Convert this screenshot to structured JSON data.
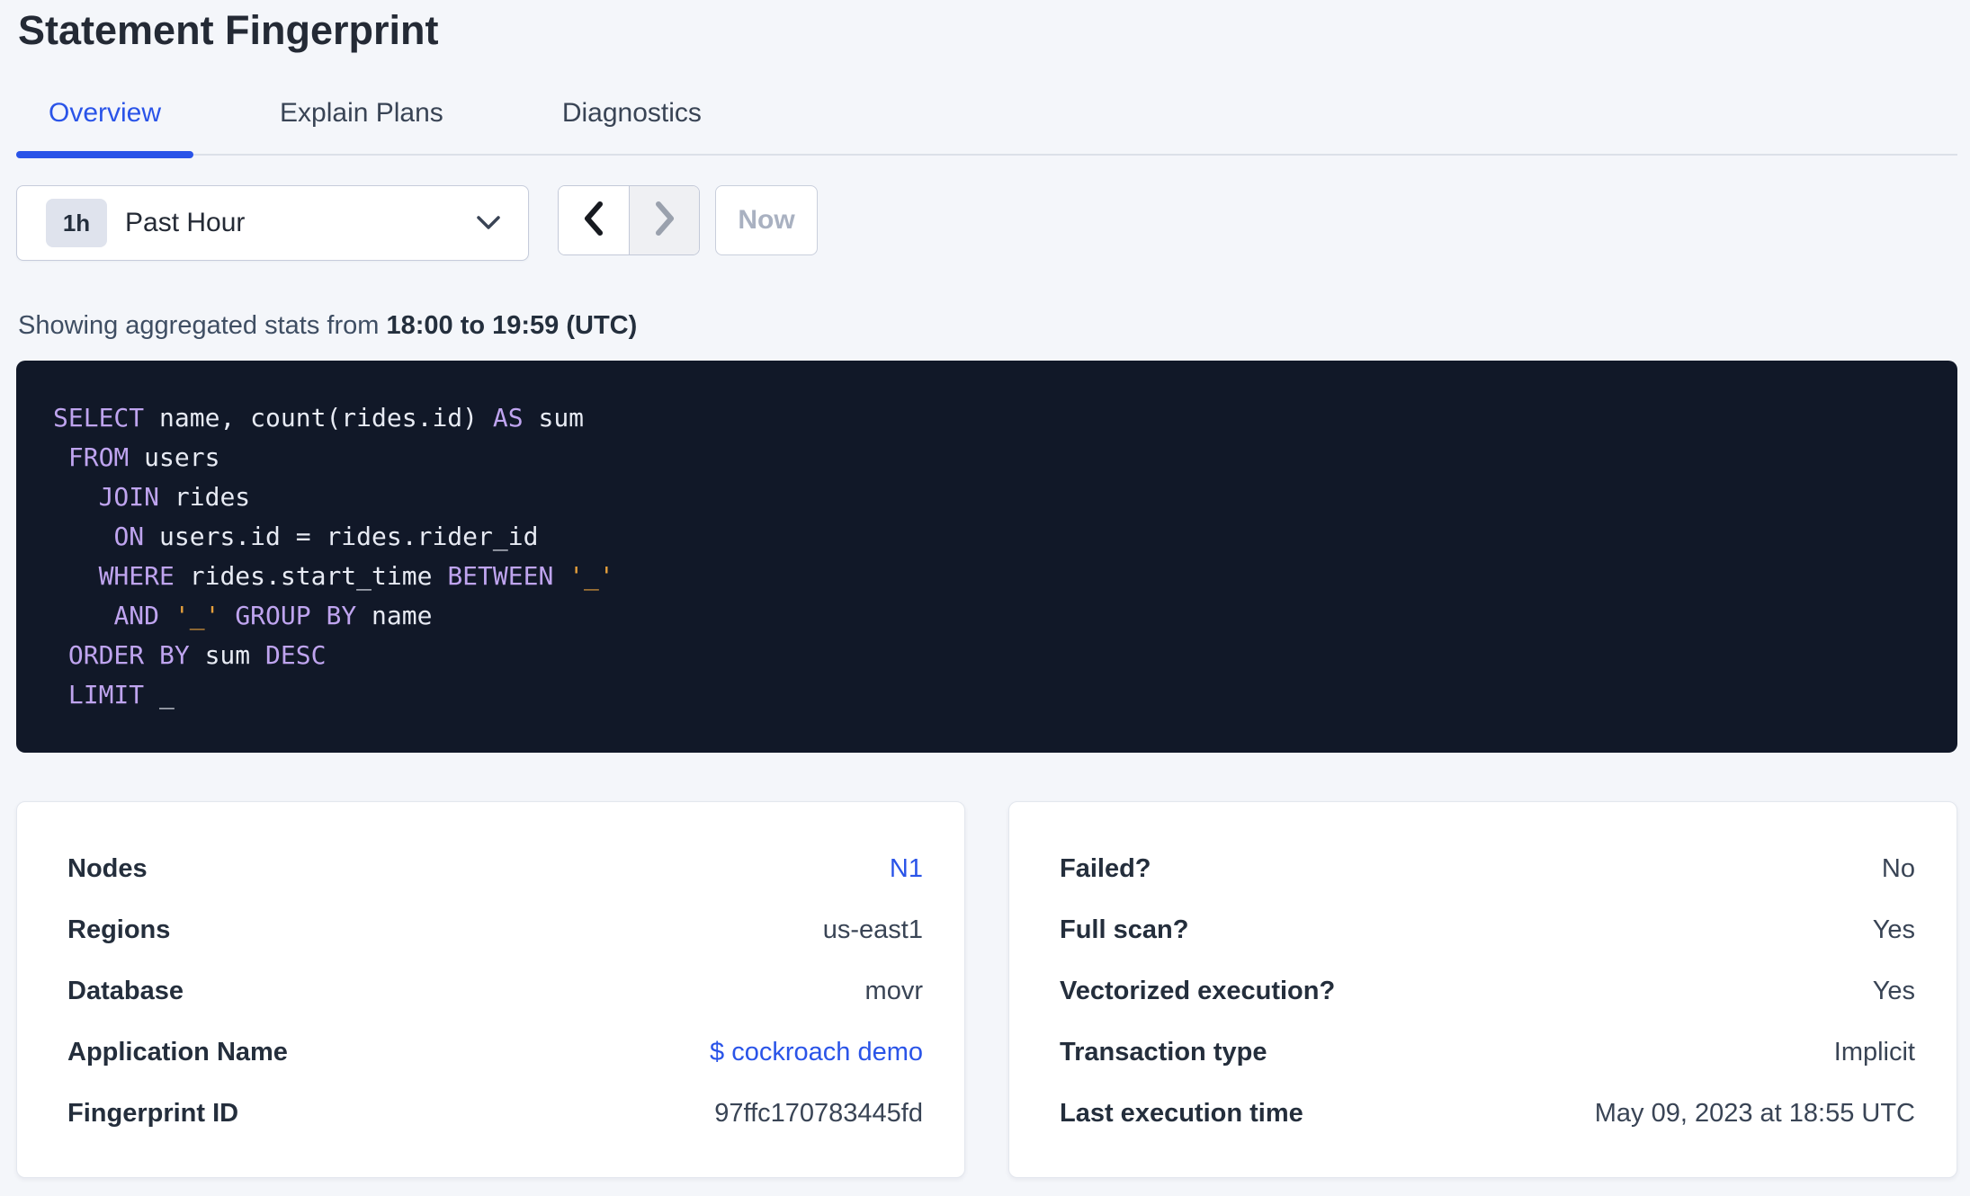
{
  "page": {
    "title": "Statement Fingerprint"
  },
  "tabs": [
    {
      "label": "Overview",
      "active": true
    },
    {
      "label": "Explain Plans",
      "active": false
    },
    {
      "label": "Diagnostics",
      "active": false
    }
  ],
  "time_controls": {
    "interval_badge": "1h",
    "range_label": "Past Hour",
    "now_label": "Now",
    "prev_enabled": true,
    "next_enabled": false
  },
  "stats_line": {
    "prefix": "Showing aggregated stats from ",
    "range": "18:00 to 19:59 (UTC)"
  },
  "sql": {
    "lines": [
      [
        {
          "c": "kw",
          "v": "SELECT"
        },
        {
          "c": "id",
          "v": " name, count(rides.id) "
        },
        {
          "c": "kw",
          "v": "AS"
        },
        {
          "c": "id",
          "v": " sum"
        }
      ],
      [
        {
          "c": "id",
          "v": " "
        },
        {
          "c": "kw",
          "v": "FROM"
        },
        {
          "c": "id",
          "v": " users"
        }
      ],
      [
        {
          "c": "id",
          "v": "   "
        },
        {
          "c": "kw",
          "v": "JOIN"
        },
        {
          "c": "id",
          "v": " rides"
        }
      ],
      [
        {
          "c": "id",
          "v": "    "
        },
        {
          "c": "kw",
          "v": "ON"
        },
        {
          "c": "id",
          "v": " users.id = rides.rider_id"
        }
      ],
      [
        {
          "c": "id",
          "v": "   "
        },
        {
          "c": "kw",
          "v": "WHERE"
        },
        {
          "c": "id",
          "v": " rides.start_time "
        },
        {
          "c": "kw",
          "v": "BETWEEN"
        },
        {
          "c": "id",
          "v": " "
        },
        {
          "c": "str",
          "v": "'_'"
        }
      ],
      [
        {
          "c": "id",
          "v": "    "
        },
        {
          "c": "kw",
          "v": "AND"
        },
        {
          "c": "id",
          "v": " "
        },
        {
          "c": "str",
          "v": "'_'"
        },
        {
          "c": "id",
          "v": " "
        },
        {
          "c": "kw",
          "v": "GROUP BY"
        },
        {
          "c": "id",
          "v": " name"
        }
      ],
      [
        {
          "c": "id",
          "v": " "
        },
        {
          "c": "kw",
          "v": "ORDER BY"
        },
        {
          "c": "id",
          "v": " sum "
        },
        {
          "c": "kw",
          "v": "DESC"
        }
      ],
      [
        {
          "c": "id",
          "v": " "
        },
        {
          "c": "kw",
          "v": "LIMIT"
        },
        {
          "c": "id",
          "v": " _"
        }
      ]
    ]
  },
  "details_left": {
    "rows": [
      {
        "label": "Nodes",
        "value": "N1",
        "is_link": true
      },
      {
        "label": "Regions",
        "value": "us-east1",
        "is_link": false
      },
      {
        "label": "Database",
        "value": "movr",
        "is_link": false
      },
      {
        "label": "Application Name",
        "value": "$ cockroach demo",
        "is_link": true
      },
      {
        "label": "Fingerprint ID",
        "value": "97ffc170783445fd",
        "is_link": false
      }
    ]
  },
  "details_right": {
    "rows": [
      {
        "label": "Failed?",
        "value": "No"
      },
      {
        "label": "Full scan?",
        "value": "Yes"
      },
      {
        "label": "Vectorized execution?",
        "value": "Yes"
      },
      {
        "label": "Transaction type",
        "value": "Implicit"
      },
      {
        "label": "Last execution time",
        "value": "May 09, 2023 at 18:55 UTC"
      }
    ]
  },
  "icons": {
    "dropdown_chevron": "chevron-down-icon",
    "prev": "chevron-left-icon",
    "next": "chevron-right-icon"
  },
  "colors": {
    "accent_blue": "#2a54e8",
    "page_background": "#f4f6fa",
    "code_background": "#111828",
    "code_keyword": "#bfa4ef",
    "code_identifier": "#e7eaf3",
    "code_string": "#e6a03c",
    "disabled_text": "#a9b1c1"
  }
}
